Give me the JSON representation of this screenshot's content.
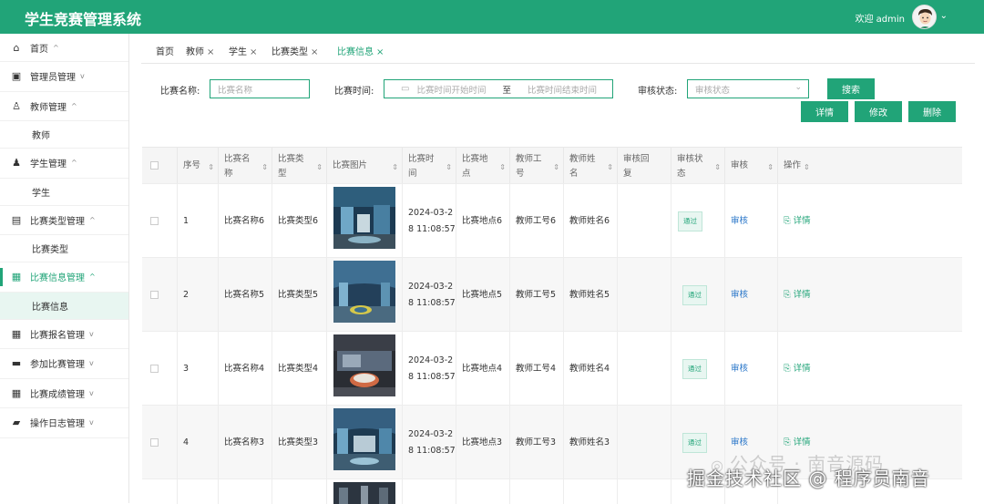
{
  "app": {
    "title": "学生竞赛管理系统",
    "welcome": "欢迎 admin"
  },
  "sidebar": {
    "items": [
      {
        "label": "首页",
        "caret": "^"
      },
      {
        "label": "管理员管理",
        "caret": "v"
      },
      {
        "label": "教师管理",
        "caret": "^"
      },
      {
        "label": "教师"
      },
      {
        "label": "学生管理",
        "caret": "^"
      },
      {
        "label": "学生"
      },
      {
        "label": "比赛类型管理",
        "caret": "^"
      },
      {
        "label": "比赛类型"
      },
      {
        "label": "比赛信息管理",
        "caret": "^"
      },
      {
        "label": "比赛信息"
      },
      {
        "label": "比赛报名管理",
        "caret": "v"
      },
      {
        "label": "参加比赛管理",
        "caret": "v"
      },
      {
        "label": "比赛成绩管理",
        "caret": "v"
      },
      {
        "label": "操作日志管理",
        "caret": "v"
      }
    ]
  },
  "tabs": [
    {
      "label": "首页"
    },
    {
      "label": "教师",
      "close": "×"
    },
    {
      "label": "学生",
      "close": "×"
    },
    {
      "label": "比赛类型",
      "close": "×"
    },
    {
      "label": "比赛信息",
      "close": "×"
    }
  ],
  "search": {
    "name_label": "比赛名称:",
    "name_placeholder": "比赛名称",
    "time_label": "比赛时间:",
    "time_start_placeholder": "比赛时间开始时间",
    "time_to": "至",
    "time_end_placeholder": "比赛时间结束时间",
    "status_label": "审核状态:",
    "status_placeholder": "审核状态",
    "search_button": "搜索",
    "detail_button": "详情",
    "edit_button": "修改",
    "delete_button": "删除"
  },
  "table": {
    "headers": [
      "序号",
      "比赛名\n称",
      "比赛类\n型",
      "比赛图片",
      "比赛时\n间",
      "比赛地\n点",
      "教师工\n号",
      "教师姓\n名",
      "审核回\n复",
      "审核状\n态",
      "审核",
      "操作"
    ],
    "rows": [
      {
        "no": "1",
        "name": "比赛名称6",
        "type": "比赛类型6",
        "time_a": "2024-03-2",
        "time_b": "8 11:08:57",
        "place": "比赛地点6",
        "tno": "教师工号6",
        "tname": "教师姓名6",
        "reply": "",
        "status": "通过",
        "audit": "审核",
        "op": "详情"
      },
      {
        "no": "2",
        "name": "比赛名称5",
        "type": "比赛类型5",
        "time_a": "2024-03-2",
        "time_b": "8 11:08:57",
        "place": "比赛地点5",
        "tno": "教师工号5",
        "tname": "教师姓名5",
        "reply": "",
        "status": "通过",
        "audit": "审核",
        "op": "详情"
      },
      {
        "no": "3",
        "name": "比赛名称4",
        "type": "比赛类型4",
        "time_a": "2024-03-2",
        "time_b": "8 11:08:57",
        "place": "比赛地点4",
        "tno": "教师工号4",
        "tname": "教师姓名4",
        "reply": "",
        "status": "通过",
        "audit": "审核",
        "op": "详情"
      },
      {
        "no": "4",
        "name": "比赛名称3",
        "type": "比赛类型3",
        "time_a": "2024-03-2",
        "time_b": "8 11:08:57",
        "place": "比赛地点3",
        "tno": "教师工号3",
        "tname": "教师姓名3",
        "reply": "",
        "status": "通过",
        "audit": "审核",
        "op": "详情"
      }
    ]
  },
  "watermark": {
    "line1": "公众号 · 南音源码",
    "line2": "掘金技术社区 @ 程序员南音"
  },
  "colors": {
    "accent": "#21a478",
    "link": "#2b77c9"
  }
}
